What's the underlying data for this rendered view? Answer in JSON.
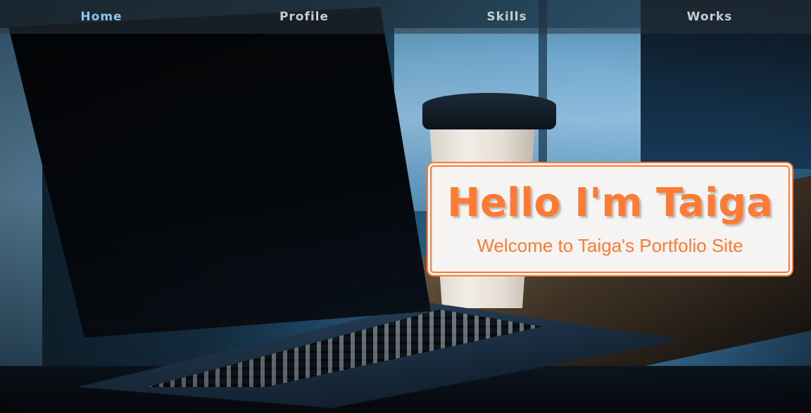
{
  "nav": {
    "items": [
      {
        "label": "Home",
        "active": true
      },
      {
        "label": "Profile",
        "active": false
      },
      {
        "label": "Skills",
        "active": false
      },
      {
        "label": "Works",
        "active": false
      }
    ]
  },
  "hero": {
    "title": "Hello I'm Taiga",
    "subtitle": "Welcome to Taiga's Portfolio Site"
  },
  "colors": {
    "accent": "#ff7a33",
    "nav_active": "#8fc4e6",
    "nav_text": "#c9cdd1",
    "card_bg": "#f5f4f3"
  }
}
